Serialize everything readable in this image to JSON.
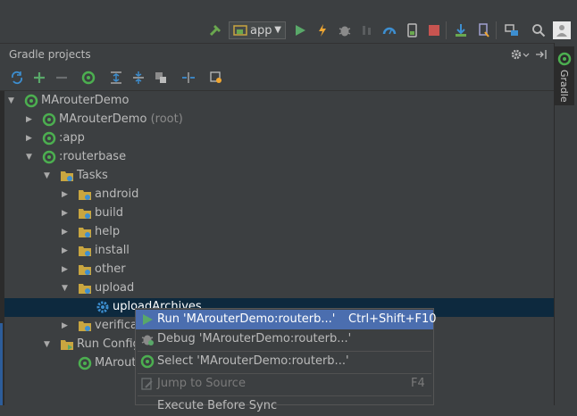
{
  "toolbar": {
    "run_config_label": "app",
    "icons": [
      "hammer-icon",
      "run-config-icon",
      "run-icon",
      "apply-changes-icon",
      "debug-icon",
      "attach-debugger-icon",
      "profile-icon",
      "device-icon",
      "stop-icon",
      "sdk-manager-icon",
      "avd-manager-icon",
      "project-structure-icon",
      "search-icon",
      "user-icon"
    ]
  },
  "sidebar_right": {
    "tab_label": "Gradle"
  },
  "panel": {
    "title": "Gradle projects",
    "toolbar_icons": [
      "refresh-icon",
      "add-icon",
      "remove-icon",
      "execute-task-icon",
      "expand-all-icon",
      "collapse-all-icon",
      "offline-mode-icon",
      "toggle-icon",
      "settings-icon"
    ]
  },
  "tree": [
    {
      "label": "MArouterDemo",
      "suffix": ""
    },
    {
      "label": "MArouterDemo",
      "suffix": "(root)"
    },
    {
      "label": ":app",
      "suffix": ""
    },
    {
      "label": ":routerbase",
      "suffix": ""
    },
    {
      "label": "Tasks",
      "suffix": ""
    },
    {
      "label": "android",
      "suffix": ""
    },
    {
      "label": "build",
      "suffix": ""
    },
    {
      "label": "help",
      "suffix": ""
    },
    {
      "label": "install",
      "suffix": ""
    },
    {
      "label": "other",
      "suffix": ""
    },
    {
      "label": "upload",
      "suffix": ""
    },
    {
      "label": "uploadArchives",
      "suffix": ""
    },
    {
      "label": "verificat",
      "suffix": ""
    },
    {
      "label": "Run Config",
      "suffix": ""
    },
    {
      "label": "MArout",
      "suffix": ""
    }
  ],
  "context_menu": {
    "items": [
      {
        "label": "Run 'MArouterDemo:routerb...'",
        "shortcut": "Ctrl+Shift+F10"
      },
      {
        "label": "Debug 'MArouterDemo:routerb...'",
        "shortcut": ""
      },
      {
        "label": "Select 'MArouterDemo:routerb...'",
        "shortcut": ""
      },
      {
        "label": "Jump to Source",
        "shortcut": "F4"
      },
      {
        "label": "Execute Before Sync",
        "shortcut": ""
      }
    ]
  },
  "colors": {
    "background": "#3c3f41",
    "selection": "#0d293e",
    "menu_highlight": "#4b6eaf",
    "gradle_green": "#4caf50"
  }
}
